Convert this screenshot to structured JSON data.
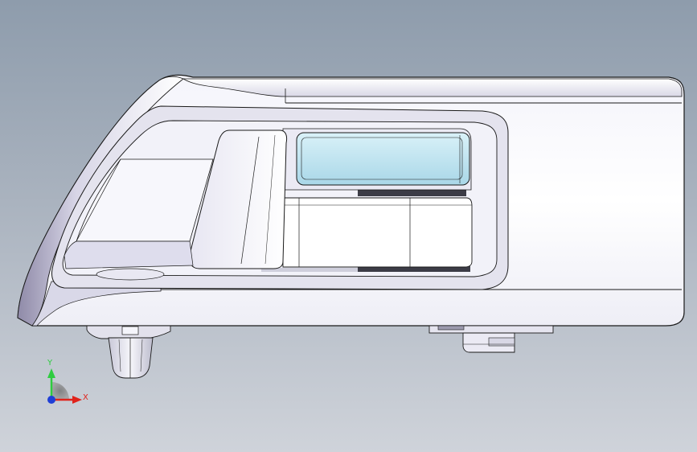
{
  "triad": {
    "y_label": "Y",
    "x_label": "X",
    "y_color": "#2ecc40",
    "x_color": "#e0231c",
    "z_color": "#1f3fd6"
  },
  "colors": {
    "background_top": "#8e9cac",
    "background_bottom": "#cfd3da",
    "part_face": "#ffffff",
    "part_shade": "#e3e3f0",
    "part_dark": "#9e9ab4",
    "edge": "#1a1a1a",
    "window_glass": "#bfe3ef",
    "slot_dark": "#3c3c46"
  }
}
